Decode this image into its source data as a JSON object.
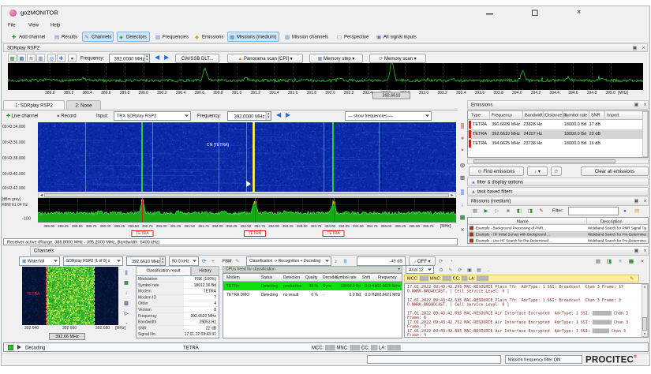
{
  "window": {
    "title": "go2MONITOR"
  },
  "menu": {
    "items": [
      "File",
      "View",
      "Help"
    ]
  },
  "toolbar": {
    "buttons": [
      {
        "label": "Add channel",
        "icon": "add-channel-icon",
        "active": false
      },
      {
        "label": "Results",
        "icon": "results-icon",
        "active": false
      },
      {
        "label": "Channels",
        "icon": "channels-icon",
        "active": true
      },
      {
        "label": "Detectors",
        "icon": "detectors-icon",
        "active": true
      },
      {
        "label": "Frequencies",
        "icon": "frequencies-icon",
        "active": false
      },
      {
        "label": "Emissions",
        "icon": "emissions-icon",
        "active": false
      },
      {
        "label": "Missions (medium)",
        "icon": "missions-icon",
        "active": true
      },
      {
        "label": "Mission channels",
        "icon": "mission-channels-icon",
        "active": false
      },
      {
        "label": "Perspective",
        "icon": "perspective-icon",
        "active": false
      },
      {
        "label": "All signal inputs",
        "icon": "signal-inputs-icon",
        "active": false
      }
    ]
  },
  "receiver": {
    "title": "SDRplay RSP2",
    "frequency_label": "Frequency:",
    "frequency": "392.0000 MHz",
    "tune_button": "CW/SSB DLT...",
    "panorama_button": "Panorama scan [CPI]",
    "memory_step_button": "Memory step",
    "memory_scan_button": "Memory scan",
    "axis": {
      "unit": "[MHz]",
      "ticks": [
        "389.0",
        "389.2",
        "389.4",
        "389.6",
        "389.8",
        "390.0",
        "390.2",
        "390.4",
        "390.6",
        "390.8",
        "391.0",
        "391.2",
        "391.4",
        "391.6",
        "391.8",
        "392.0",
        "392.2",
        "392.4",
        "392.6",
        "392.8",
        "393.0",
        "393.2",
        "393.4",
        "393.6",
        "393.8",
        "394.0",
        "394.2",
        "394.4",
        "394.6",
        "394.8",
        "395.0"
      ]
    },
    "marker": "392.6610"
  },
  "spectrum_view": {
    "tabs": [
      "1: SDRplay RSP2",
      "2: None"
    ],
    "live_channel": "Live channel",
    "record": "Record",
    "input_label": "Input:",
    "input_value": "TRX SDRplay RSP2",
    "frequency_label": "Frequency:",
    "frequency": "392.0000 MHz",
    "show_frequencies": "— show frequencies —",
    "times": [
      "09:43:34.000",
      "09:43:36.000",
      "09:43:38.000",
      "09:43:40.000",
      "09:43:42.000"
    ],
    "cn_label": "CN [TETRA]",
    "y_label": "[dBm grey]",
    "rbw_label": "RBW 61.04 Hz",
    "y_min": "-100",
    "axis": {
      "unit": "[MHz]",
      "ticks": [
        "389.00",
        "389.25",
        "389.50",
        "389.75",
        "390.00",
        "390.25",
        "390.50",
        "390.75",
        "391.00",
        "391.25",
        "391.50",
        "391.75",
        "392.00",
        "392.25",
        "392.50",
        "392.75",
        "393.00",
        "393.25",
        "393.50",
        "393.75",
        "394.00",
        "394.25",
        "394.50",
        "394.75",
        "395.00",
        "395.25",
        "395.50",
        "395.75"
      ]
    },
    "markers": [
      {
        "label": "TETRA",
        "f": 390.66
      },
      {
        "label": "TETRA",
        "f": 392.66
      },
      {
        "label": "TETRA",
        "f": 394.06
      }
    ],
    "status": "Receiver active (Range: 388.8000 MHz - 395.2000 MHz, Bandwidth: 6400 kHz)"
  },
  "emissions": {
    "title": "Emissions",
    "columns": [
      "Type",
      "Frequency",
      "Bandwidth",
      "Distance [k",
      "Symbol rate",
      "SNR",
      "Import"
    ],
    "rows": [
      {
        "type": "TETRA",
        "frequency": "390.6609 MHz",
        "bandwidth": "23828 Hz",
        "distance": "",
        "symbol_rate": "18000.0 Bd",
        "snr": "17 dB",
        "import": "",
        "selected": false
      },
      {
        "type": "TETRA",
        "frequency": "392.6610 MHz",
        "bandwidth": "24207 Hz",
        "distance": "",
        "symbol_rate": "18000.0 Bd",
        "snr": "20 dB",
        "import": "",
        "selected": true
      },
      {
        "type": "TETRA",
        "frequency": "394.0625 MHz",
        "bandwidth": "23738 Hz",
        "distance": "",
        "symbol_rate": "18000.0 Bd",
        "snr": "16 dB",
        "import": "",
        "selected": false
      }
    ],
    "find_button": "Find emissions",
    "clear_button": "Clear all emissions",
    "filter_section": "filter & display options",
    "tasks_section": "task based filters"
  },
  "missions": {
    "title": "Missions (medium)",
    "filter_label": "Filter:",
    "columns": [
      "Name",
      "Description"
    ],
    "rows": [
      {
        "name": "Example - Background Processing of PMR...",
        "description": "Wideband Search for PMR Signal Typ...",
        "selected": false
      },
      {
        "name": "Example - HF Initial Survey with Background ...",
        "description": "Wideband Search for Pre-Determined ...",
        "selected": true
      },
      {
        "name": "Example - Live HF Search for Pre-Determined ...",
        "description": "Wideband Search for Pre-Determined ...",
        "selected": false
      }
    ]
  },
  "channels": {
    "title": "Channels",
    "view_select": "Waterfall",
    "input_select": "SDRplay RSP2 (1 of 8) x",
    "frequency": "392.6610 MHz",
    "bandwidth": "50.0 kHz",
    "fbm_label": "FBM",
    "mode_select": "Classification -> Recognition + Decoding",
    "level_value": "-49 dB",
    "audio_label": "OFF",
    "axis_ticks": [
      "392.640",
      "392.660",
      "392.680"
    ],
    "axis_unit": "[MHz]",
    "marker": "392.66 MHz",
    "tetra_label": "TETRA",
    "classification": {
      "tabs": [
        "Classification result",
        "History"
      ],
      "rows": [
        [
          "Modulation",
          "PSK (100%)"
        ],
        [
          "Symbol rate",
          "18012.36 Bd"
        ],
        [
          "Modem",
          "TETRA"
        ],
        [
          "Modem ID",
          "7"
        ],
        [
          "Order",
          "4"
        ],
        [
          "Version",
          "8"
        ],
        [
          "Frequency",
          "392.6620 MHz"
        ],
        [
          "Bandwidth",
          "25053 Hz"
        ],
        [
          "SNR",
          "22 dB"
        ],
        [
          "Signal No.",
          "17.01.22 09:43:31"
        ]
      ]
    },
    "cpu": {
      "title": "CPUs freed for classification",
      "columns": [
        "Modem",
        "Status",
        "Detection",
        "Quality",
        "Decoder",
        "Symbol rate",
        "Shift",
        "Frequency"
      ],
      "rows": [
        {
          "cells": [
            "TETRA",
            "Detecting",
            "production",
            "98 %",
            "Sync",
            "18000.0 Bd",
            "0.0 Hz",
            "392.6620 MHz"
          ],
          "highlight": true
        },
        {
          "cells": [
            "TETRA DMO",
            "Detecting",
            "no result",
            "0 %",
            "-",
            "0.0 Bd",
            "0.0 Hz",
            "392.6621 MHz"
          ],
          "highlight": false
        }
      ]
    },
    "decoder": {
      "font": "Arial 12",
      "header": "MCC: ███  MNC: ███  CC: ██  LA: ████",
      "lines": [
        "17.01.2022 09:43:42.295 MAC-RESOURCE Plain Tfr  AdrType: 1 SSI: Broadcast  Chan 3 Frame: 17",
        "D-NWRK-BROADCAST, [ Cell service Level: 0 ]",
        "",
        "17.01.2022 09:43:42.635 MAC-RESOURCE Plain Tfr  AdrType: 1 SSI: Broadcast  Chan 3 Frame: 3",
        "D-NWRK-BROADCAST, [ Cell service Level: 0 ]",
        "",
        "17.01.2022 09:43:42.695 MAC-RESOURCE Air Interface Encrypted  AdrType: 1 SSI: ████████ Chan 3",
        "Frame: 6",
        "17.01.2022 09:43:42.752 MAC-RESOURCE Air Interface Encrypted  AdrType: 1 SSI: ████████ Chan 3",
        "Frame: 7",
        "17.01.2022 09:43:42.885 MAC-RESOURCE Air Interface Encrypted  AdrType: 1 SSI: ███████ Chan 3",
        "Frame: 9"
      ]
    },
    "status": {
      "state": "Decoding",
      "modem": "TETRA",
      "info": "MCC: ███ MNC: ███ CC: ██ LA: ████"
    }
  },
  "statusbar": {
    "mission_filter": "Mission frequency filter ON",
    "brand": "PROCITEC",
    "registered": "®"
  }
}
